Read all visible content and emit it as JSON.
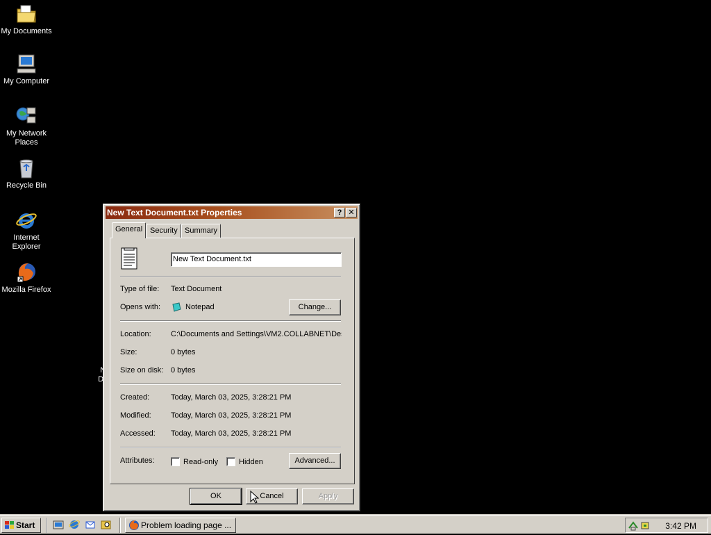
{
  "desktop": {
    "icons": [
      {
        "label": "My Documents",
        "icon": "folder-documents-icon"
      },
      {
        "label": "My Computer",
        "icon": "computer-icon"
      },
      {
        "label": "My Network Places",
        "icon": "network-icon"
      },
      {
        "label": "Recycle Bin",
        "icon": "recycle-bin-icon"
      },
      {
        "label": "Internet Explorer",
        "icon": "internet-explorer-icon"
      },
      {
        "label": "Mozilla Firefox",
        "icon": "firefox-icon"
      }
    ],
    "partial_file_icon": {
      "line1": "Nev",
      "line2": "Docu"
    }
  },
  "dialog": {
    "title": "New Text Document.txt Properties",
    "help_btn": "?",
    "close_btn": "✕",
    "tabs": [
      "General",
      "Security",
      "Summary"
    ],
    "file_name": "New Text Document.txt",
    "type_label": "Type of file:",
    "type_value": "Text Document",
    "opens_label": "Opens with:",
    "opens_value": "Notepad",
    "change_btn": "Change...",
    "location_label": "Location:",
    "location_value": "C:\\Documents and Settings\\VM2.COLLABNET\\Des",
    "size_label": "Size:",
    "size_value": "0 bytes",
    "size_disk_label": "Size on disk:",
    "size_disk_value": "0 bytes",
    "created_label": "Created:",
    "created_value": "Today, March 03, 2025, 3:28:21 PM",
    "modified_label": "Modified:",
    "modified_value": "Today, March 03, 2025, 3:28:21 PM",
    "accessed_label": "Accessed:",
    "accessed_value": "Today, March 03, 2025, 3:28:21 PM",
    "attributes_label": "Attributes:",
    "readonly_label": "Read-only",
    "hidden_label": "Hidden",
    "advanced_btn": "Advanced...",
    "ok_btn": "OK",
    "cancel_btn": "Cancel",
    "apply_btn": "Apply"
  },
  "taskbar": {
    "start_label": "Start",
    "task_label": "Problem loading page ...",
    "clock": "3:42 PM"
  }
}
